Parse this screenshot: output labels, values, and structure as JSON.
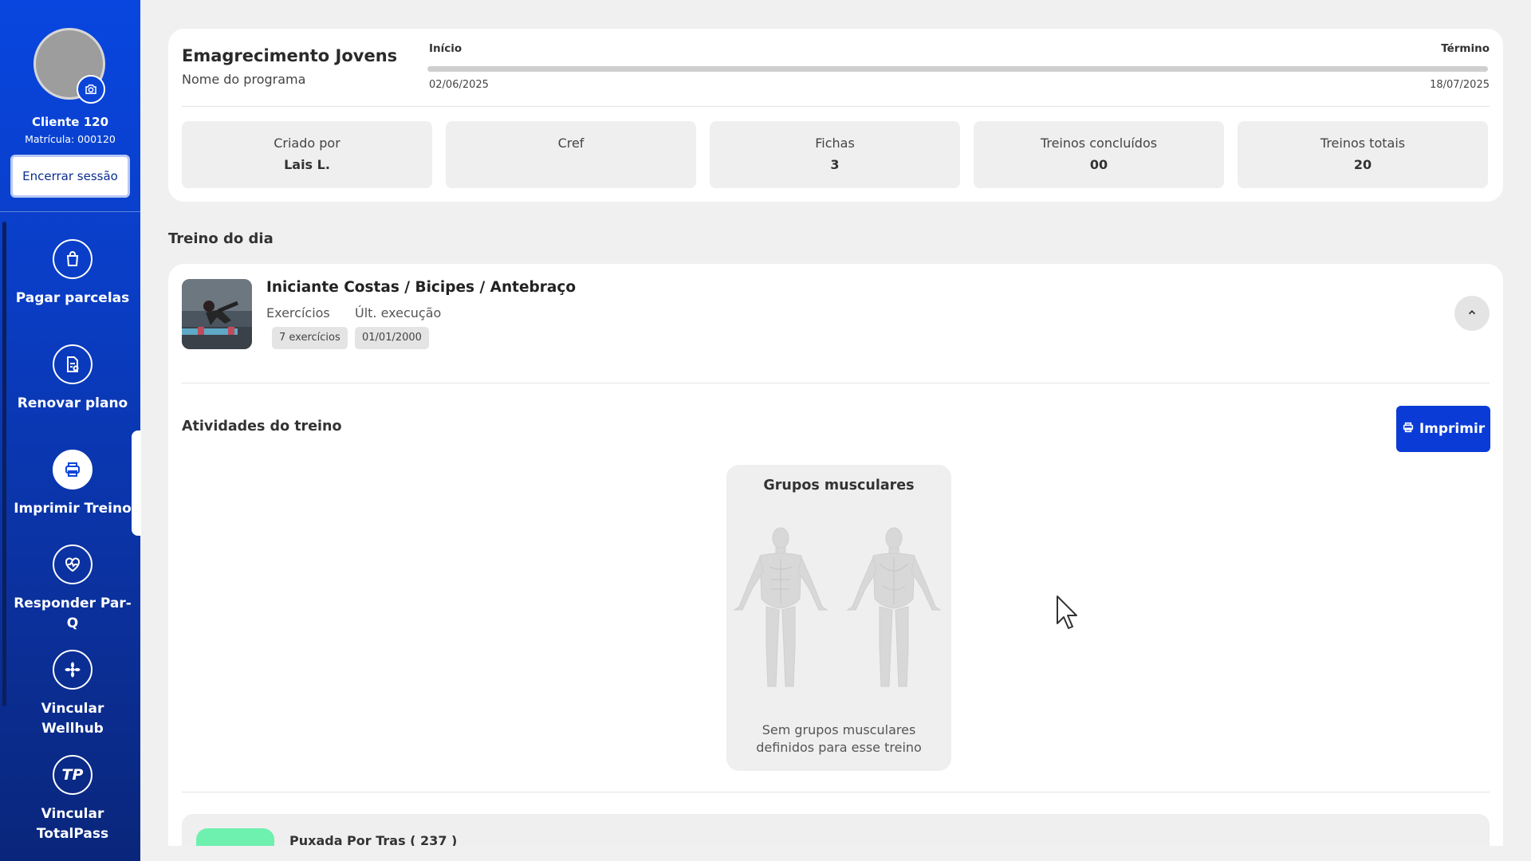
{
  "profile": {
    "name": "Cliente 120",
    "registration": "Matrícula: 000120",
    "logout_label": "Encerrar sessão"
  },
  "menu": {
    "items": [
      {
        "label": "Pagar parcelas",
        "icon": "shopping-bag-icon"
      },
      {
        "label": "Renovar plano",
        "icon": "document-renew-icon"
      },
      {
        "label": "Imprimir Treino",
        "icon": "printer-icon",
        "active": true
      },
      {
        "label": "Responder Par-Q",
        "icon": "heart-pulse-icon"
      },
      {
        "label": "Vincular Wellhub",
        "icon": "wellhub-icon"
      },
      {
        "label": "Vincular TotalPass",
        "icon": "totalpass-icon"
      }
    ]
  },
  "program": {
    "title": "Emagrecimento Jovens",
    "subtitle": "Nome do programa",
    "start_label": "Início",
    "end_label": "Término",
    "start_date": "02/06/2025",
    "end_date": "18/07/2025",
    "progress_percent": 0
  },
  "stats": [
    {
      "label": "Criado por",
      "value": "Lais L."
    },
    {
      "label": "Cref",
      "value": ""
    },
    {
      "label": "Fichas",
      "value": "3"
    },
    {
      "label": "Treinos concluídos",
      "value": "00"
    },
    {
      "label": "Treinos totais",
      "value": "20"
    }
  ],
  "workout": {
    "section_title": "Treino do dia",
    "name": "Iniciante Costas / Bicipes / Antebraço",
    "exercises_label": "Exercícios",
    "last_exec_label": "Últ. execução",
    "exercises_count": "7 exercícios",
    "last_exec_date": "01/01/2000"
  },
  "activities": {
    "title": "Atividades do treino",
    "print_label": "Imprimir",
    "muscle_title": "Grupos musculares",
    "muscle_empty": "Sem grupos musculares definidos para esse treino"
  },
  "exercise_list": [
    {
      "name": "Puxada Por Tras ( 237 )"
    }
  ],
  "colors": {
    "brand": "#0b45d8",
    "sidebar_bottom": "#0a267b",
    "accent_green": "#6ef0ae",
    "background": "#f0f0f1"
  }
}
